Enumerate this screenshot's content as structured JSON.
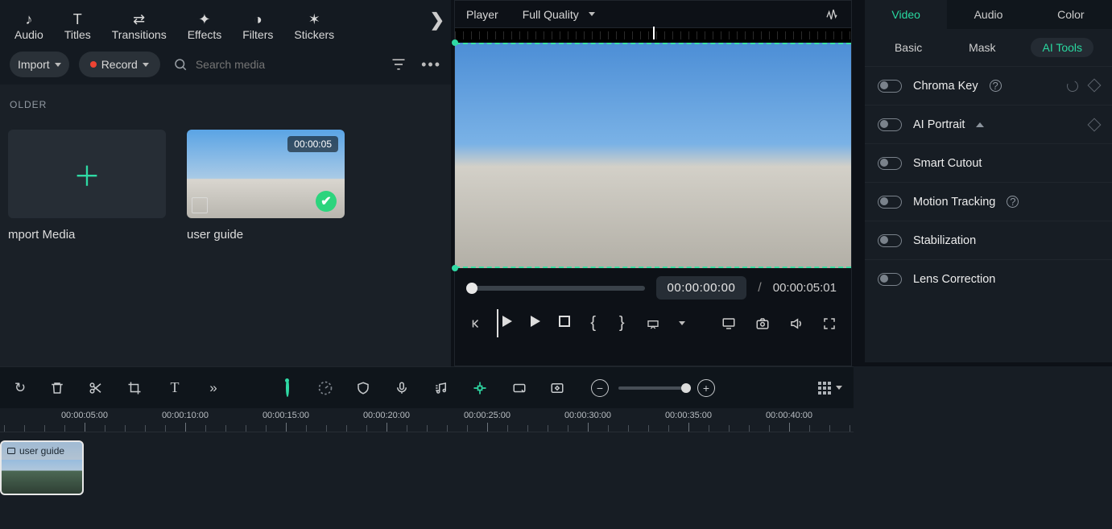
{
  "top_nav": {
    "items": [
      {
        "label": "Audio",
        "icon": "♪"
      },
      {
        "label": "Titles",
        "icon": "T"
      },
      {
        "label": "Transitions",
        "icon": "⇄"
      },
      {
        "label": "Effects",
        "icon": "✦"
      },
      {
        "label": "Filters",
        "icon": "◑"
      },
      {
        "label": "Stickers",
        "icon": "✶"
      }
    ]
  },
  "media_toolbar": {
    "import_label": "Import",
    "record_label": "Record",
    "search_placeholder": "Search media"
  },
  "media_bin": {
    "folder_header": "OLDER",
    "import_card_label": "mport Media",
    "clip": {
      "duration": "00:00:05",
      "label": "user guide"
    }
  },
  "player": {
    "title": "Player",
    "quality_label": "Full Quality",
    "current_time": "00:00:00:00",
    "separator": "/",
    "total_time": "00:00:05:01"
  },
  "properties": {
    "tabs": [
      "Video",
      "Audio",
      "Color"
    ],
    "active_tab": 0,
    "sub_tabs": [
      "Basic",
      "Mask",
      "AI Tools"
    ],
    "active_sub_tab": 2,
    "ai_tools": [
      {
        "name": "Chroma Key",
        "help": true,
        "reset": true,
        "keyframe": true,
        "expand": false
      },
      {
        "name": "AI Portrait",
        "help": false,
        "reset": false,
        "keyframe": true,
        "expand": true
      },
      {
        "name": "Smart Cutout",
        "help": false,
        "reset": false,
        "keyframe": false,
        "expand": false
      },
      {
        "name": "Motion Tracking",
        "help": true,
        "reset": false,
        "keyframe": false,
        "expand": false
      },
      {
        "name": "Stabilization",
        "help": false,
        "reset": false,
        "keyframe": false,
        "expand": false
      },
      {
        "name": "Lens Correction",
        "help": false,
        "reset": false,
        "keyframe": false,
        "expand": false
      }
    ]
  },
  "timeline": {
    "ruler_labels": [
      "00:00:05:00",
      "00:00:10:00",
      "00:00:15:00",
      "00:00:20:00",
      "00:00:25:00",
      "00:00:30:00",
      "00:00:35:00",
      "00:00:40:00"
    ],
    "clip_name": "user guide"
  }
}
